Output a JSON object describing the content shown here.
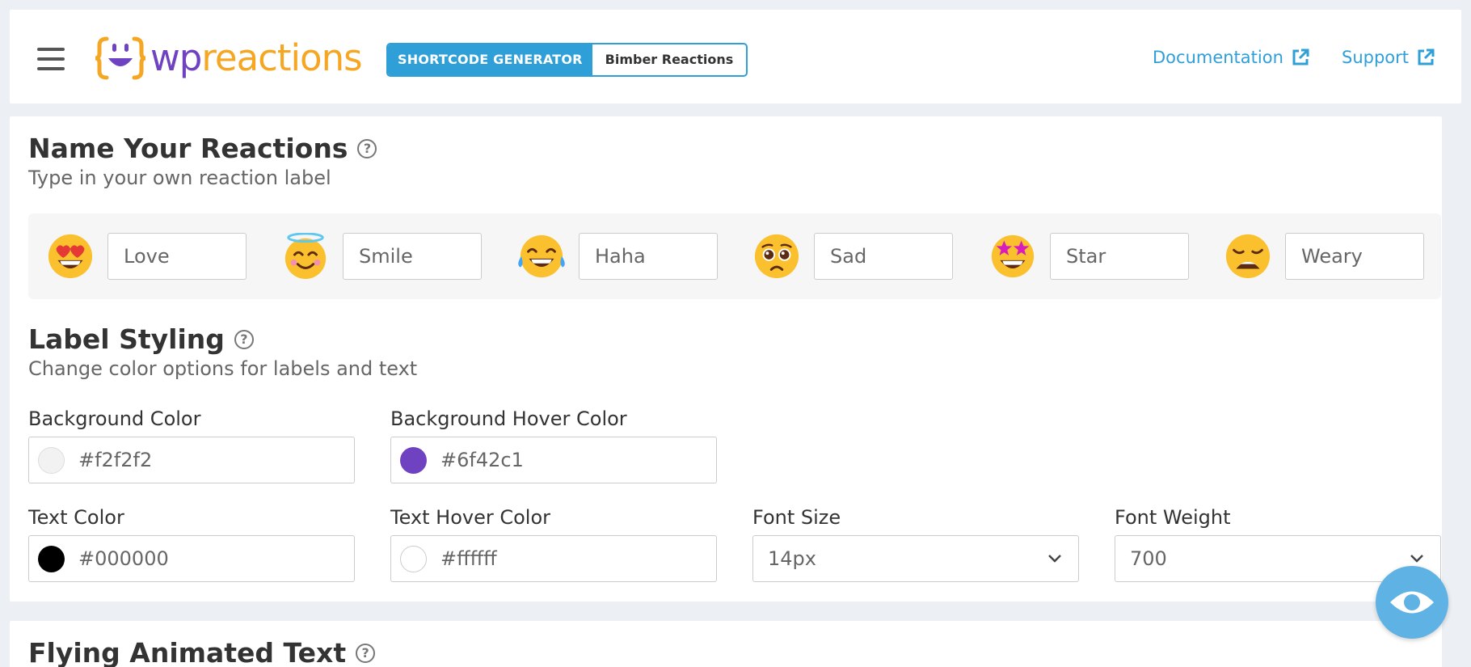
{
  "header": {
    "brand": {
      "wp": "wp",
      "reactions": "reactions"
    },
    "mode_badge": "SHORTCODE GENERATOR",
    "current_shortcode": "Bimber Reactions",
    "links": {
      "documentation": "Documentation",
      "support": "Support"
    },
    "colors": {
      "accent": "#2f9fd8",
      "brand_purple": "#6f42c1",
      "brand_orange": "#f5a623"
    }
  },
  "name_reactions": {
    "title": "Name Your Reactions",
    "subtitle": "Type in your own reaction label",
    "help": "?",
    "items": [
      {
        "emoji": "heart-eyes-emoji",
        "value": "Love"
      },
      {
        "emoji": "smiling-halo-emoji",
        "value": "Smile"
      },
      {
        "emoji": "tears-of-joy-emoji",
        "value": "Haha"
      },
      {
        "emoji": "pleading-face-emoji",
        "value": "Sad"
      },
      {
        "emoji": "star-struck-emoji",
        "value": "Star"
      },
      {
        "emoji": "weary-face-emoji",
        "value": "Weary"
      }
    ]
  },
  "label_styling": {
    "title": "Label Styling",
    "subtitle": "Change color options for labels and text",
    "help": "?",
    "background_color": {
      "label": "Background Color",
      "value": "#f2f2f2"
    },
    "background_hover_color": {
      "label": "Background Hover Color",
      "value": "#6f42c1"
    },
    "text_color": {
      "label": "Text Color",
      "value": "#000000"
    },
    "text_hover_color": {
      "label": "Text Hover Color",
      "value": "#ffffff"
    },
    "font_size": {
      "label": "Font Size",
      "value": "14px"
    },
    "font_weight": {
      "label": "Font Weight",
      "value": "700"
    }
  },
  "flying_text": {
    "title": "Flying Animated Text",
    "help": "?"
  },
  "preview_button": {
    "icon": "eye-icon"
  }
}
